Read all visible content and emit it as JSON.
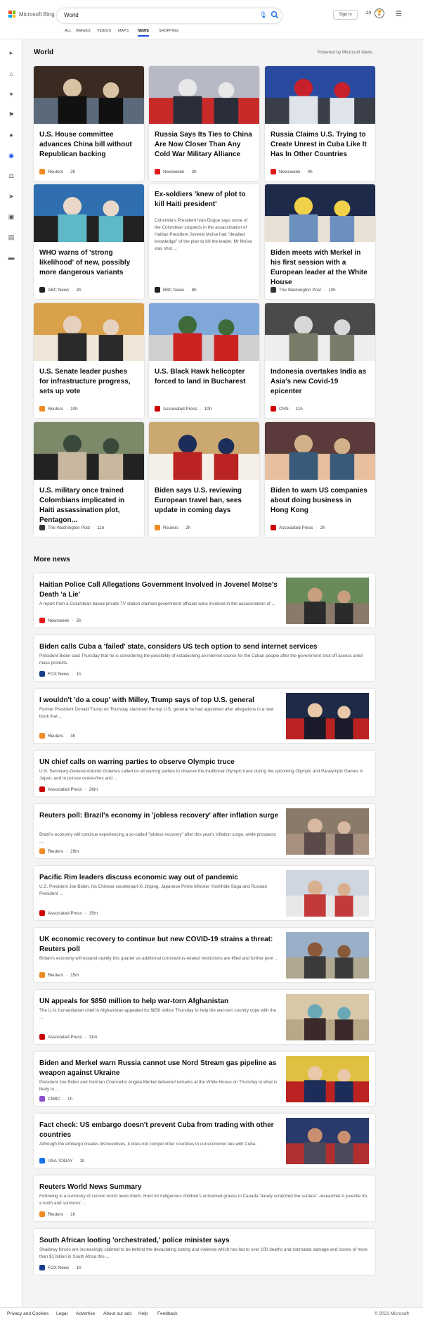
{
  "header": {
    "brand": "Microsoft Bing",
    "search_value": "World",
    "signin": "Sign in",
    "points": "20",
    "tabs": [
      "ALL",
      "IMAGES",
      "VIDEOS",
      "MAPS",
      "NEWS",
      "SHOPPING"
    ],
    "active_tab": "NEWS"
  },
  "section": {
    "title": "World",
    "powered": "Powered by Microsoft News"
  },
  "cards": [
    {
      "title": "U.S. House committee advances China bill without Republican backing",
      "source": "Reuters",
      "time": "2h",
      "icon_color": "#f08a24"
    },
    {
      "title": "Russia Says Its Ties to China Are Now Closer Than Any Cold War Military Alliance",
      "source": "Newsweek",
      "time": "3h",
      "icon_color": "#e21b1b"
    },
    {
      "title": "Russia Claims U.S. Trying to Create Unrest in Cuba Like It Has In Other Countries",
      "source": "Newsweek",
      "time": "4h",
      "icon_color": "#e21b1b"
    },
    {
      "title": "WHO warns of 'strong likelihood' of new, possibly more dangerous variants",
      "source": "ABC News",
      "time": "4h",
      "icon_color": "#222"
    },
    {
      "title": "Ex-soldiers 'knew of plot to kill Haiti president'",
      "snippet": "Colombia's President Iván Duque says some of the Colombian suspects in the assassination of Haitian President Jovenel Moïse had \"detailed knowledge\" of the plan to kill the leader. Mr Moïse was shot ...",
      "source": "BBC News",
      "time": "8h",
      "icon_color": "#222"
    },
    {
      "title": "Biden meets with Merkel in his first session with a European leader at the White House",
      "source": "The Washington Post",
      "time": "10h",
      "icon_color": "#333"
    },
    {
      "title": "U.S. Senate leader pushes for infrastructure progress, sets up vote",
      "source": "Reuters",
      "time": "10h",
      "icon_color": "#f08a24"
    },
    {
      "title": "U.S. Black Hawk helicopter forced to land in Bucharest",
      "source": "Associated Press",
      "time": "10h",
      "icon_color": "#c00"
    },
    {
      "title": "Indonesia overtakes India as Asia's new Covid-19 epicenter",
      "source": "CNN",
      "time": "11h",
      "icon_color": "#cc0000"
    },
    {
      "title": "U.S. military once trained Colombians implicated in Haiti assassination plot, Pentagon...",
      "source": "The Washington Post",
      "time": "11h",
      "icon_color": "#333"
    },
    {
      "title": "Biden says U.S. reviewing European travel ban, sees update in coming days",
      "source": "Reuters",
      "time": "2h",
      "icon_color": "#f08a24"
    },
    {
      "title": "Biden to warn US companies about doing business in Hong Kong",
      "source": "Associated Press",
      "time": "2h",
      "icon_color": "#c00"
    }
  ],
  "more_news_title": "More news",
  "more_news": [
    {
      "title": "Haitian Police Call Allegations Government Involved in Jovenel Moïse's Death 'a Lie'",
      "snippet": "A report from a Columbian-based private TV station claimed government officials were involved in the assassination of ...",
      "source": "Newsweek",
      "time": "5h",
      "icon_color": "#e21b1b"
    },
    {
      "title": "Biden calls Cuba a 'failed' state, considers US tech option to send internet services",
      "snippet": "President Biden said Thursday that he is considering the possibility of establishing an internet source for the Cuban people after the government shut off access amid mass protests.",
      "source": "FOX News",
      "time": "1h",
      "icon_color": "#1a3c8f"
    },
    {
      "title": "I wouldn't 'do a coup' with Milley, Trump says of top U.S. general",
      "snippet": "Former President Donald Trump on Thursday slammed the top U.S. general he had appointed after allegations in a new book that ...",
      "source": "Reuters",
      "time": "3h",
      "icon_color": "#f08a24"
    },
    {
      "title": "UN chief calls on warring parties to observe Olympic truce",
      "snippet": "U.N. Secretary-General Antonio Guterres called on all warring parties to observe the traditional Olympic truce during the upcoming Olympic and Paralympic Games in Japan, and to pursue cease-fires and ...",
      "source": "Associated Press",
      "time": "26m",
      "icon_color": "#c00"
    },
    {
      "title": "Reuters poll: Brazil's economy in 'jobless recovery' after inflation surge",
      "snippet": "Brazil's economy will continue experiencing a so-called \"jobless recovery\" after this year's inflation surge, while prospects ...",
      "source": "Reuters",
      "time": "29m",
      "icon_color": "#f08a24"
    },
    {
      "title": "Pacific Rim leaders discuss economic way out of pandemic",
      "snippet": "U.S. President Joe Biden, his Chinese counterpart Xi Jinping, Japanese Prime Minister Yoshihide Suga and Russian President ...",
      "source": "Associated Press",
      "time": "35m",
      "icon_color": "#c00"
    },
    {
      "title": "UK economic recovery to continue but new COVID-19 strains a threat: Reuters poll",
      "snippet": "Britain's economy will expand rapidly this quarter as additional coronavirus-related restrictions are lifted and further pent ...",
      "source": "Reuters",
      "time": "15m",
      "icon_color": "#f08a24"
    },
    {
      "title": "UN appeals for $850 million to help war-torn Afghanistan",
      "snippet": "The U.N. humanitarian chief in Afghanistan appealed for $850 million Thursday to help the war-torn country cope with the ...",
      "source": "Associated Press",
      "time": "11m",
      "icon_color": "#c00"
    },
    {
      "title": "Biden and Merkel warn Russia cannot use Nord Stream gas pipeline as weapon against Ukraine",
      "snippet": "President Joe Biden and German Chancellor Angela Merkel delivered remarks at the White House on Thursday in what is likely to ...",
      "source": "CNBC",
      "time": "1h",
      "icon_color": "#8a4fd0"
    },
    {
      "title": "Fact check: US embargo doesn't prevent Cuba from trading with other countries",
      "snippet": "Although the embargo creates disincentives, it does not compel other countries to cut economic ties with Cuba.",
      "source": "USA TODAY",
      "time": "1h",
      "icon_color": "#1a73e8"
    },
    {
      "title": "Reuters World News Summary",
      "snippet": "Following is a summary of current world news briefs. Hunt for indigenous children's unmarked graves in Canada 'barely scratched the surface' -researcher A juvenile rib, a tooth and survivors' ...",
      "source": "Reuters",
      "time": "1h",
      "icon_color": "#f08a24"
    },
    {
      "title": "South African looting 'orchestrated,' police minister says",
      "snippet": "Shadowy forces are increasingly claimed to be behind the devastating looting and violence which has led to over 100 deaths and estimated damage and losses of more than $1 billion in South Africa this ...",
      "source": "FOX News",
      "time": "1h",
      "icon_color": "#1a3c8f"
    }
  ],
  "footer": {
    "links": [
      "Privacy and Cookies",
      "Legal",
      "Advertise",
      "About our ads",
      "Help",
      "Feedback"
    ],
    "copyright": "© 2021 Microsoft"
  }
}
